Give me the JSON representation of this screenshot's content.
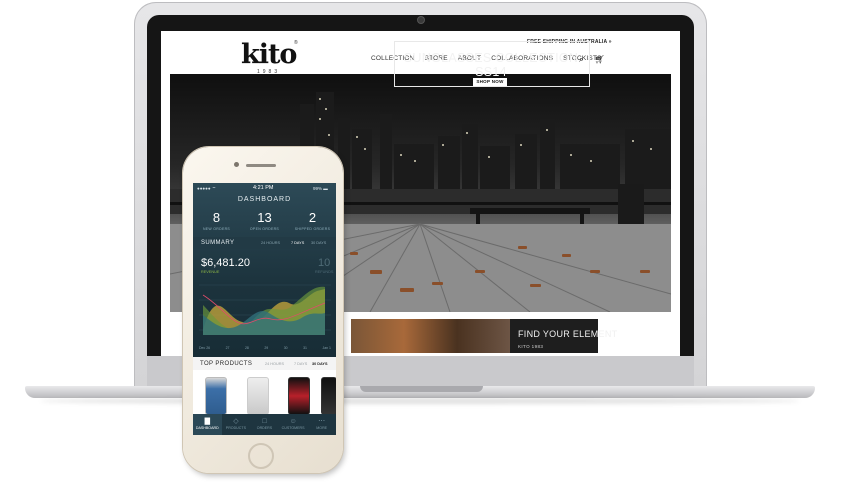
{
  "website": {
    "logo_text": "kito",
    "logo_sub": "1983",
    "logo_reg": "®",
    "shipping_banner": "FREE SHIPPING IN AUSTRALIA »",
    "nav": [
      "COLLECTION",
      "STORE",
      "ABOUT",
      "COLLABORATIONS",
      "STOCKISTS"
    ],
    "search_icon": "search-icon",
    "cart_icon": "cart-icon",
    "hero_title": "SUNGLASSES COLLECTION SS14",
    "hero_button": "SHOP NOW",
    "promo_title": "FIND YOUR ELEMENT",
    "promo_sub": "KITO 1983"
  },
  "phone": {
    "status": {
      "carrier": "●●●●● ⌔",
      "time": "4:21 PM",
      "battery": "99% ▬"
    },
    "dashboard_title": "DASHBOARD",
    "stats": [
      {
        "value": "8",
        "label": "NEW ORDERS"
      },
      {
        "value": "13",
        "label": "OPEN ORDERS"
      },
      {
        "value": "2",
        "label": "SHIPPED ORDERS"
      }
    ],
    "summary": {
      "label": "SUMMARY",
      "tabs": [
        "24 HOURS",
        "7 DAYS",
        "30 DAYS"
      ],
      "active_tab": "7 DAYS",
      "revenue_value": "$6,481.20",
      "revenue_label": "REVENUE",
      "refunds_value": "10",
      "refunds_label": "REFUNDS"
    },
    "chart_x_labels": [
      "Dec 26",
      "27",
      "28",
      "29",
      "30",
      "31",
      "Jan 1"
    ],
    "top_products": {
      "label": "TOP PRODUCTS",
      "tabs": [
        "24 HOURS",
        "7 DAYS",
        "30 DAYS"
      ],
      "active_tab": "30 DAYS"
    },
    "tabbar": [
      {
        "label": "DASHBOARD",
        "icon": "chart-icon"
      },
      {
        "label": "PRODUCTS",
        "icon": "tag-icon"
      },
      {
        "label": "ORDERS",
        "icon": "cart-icon"
      },
      {
        "label": "CUSTOMERS",
        "icon": "users-icon"
      },
      {
        "label": "MORE",
        "icon": "more-icon"
      }
    ]
  },
  "colors": {
    "phone_bg": "#1c333d",
    "revenue_green": "#8eb846",
    "chart_yellow": "#c9a93b",
    "chart_green": "#6c9a3c",
    "chart_teal": "#2f6f7a"
  }
}
